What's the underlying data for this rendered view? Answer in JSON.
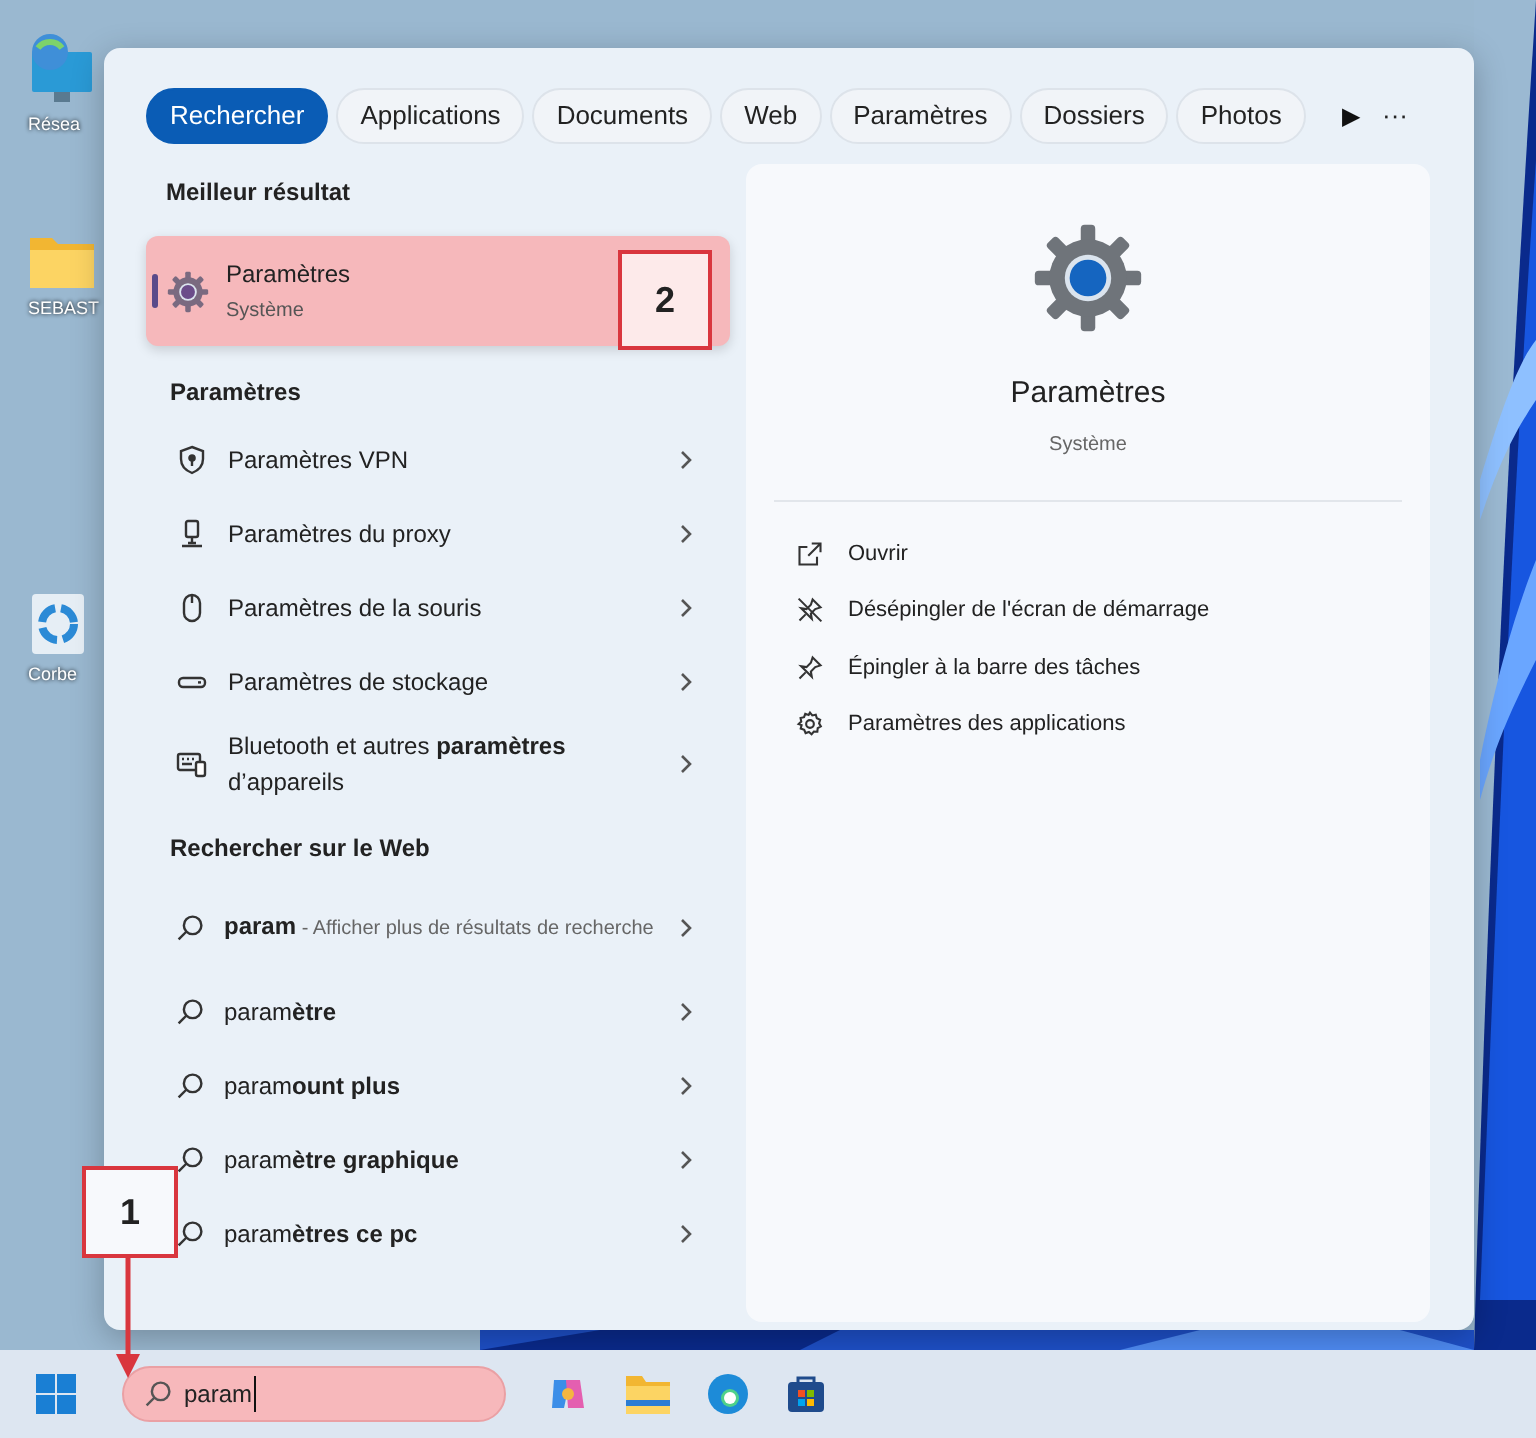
{
  "desktop_icons": [
    {
      "kind": "network",
      "label": "Résea"
    },
    {
      "kind": "folder",
      "label": "SEBAST"
    },
    {
      "kind": "recycle",
      "label": "Corbe"
    }
  ],
  "tabs": [
    {
      "label": "Rechercher",
      "selected": true
    },
    {
      "label": "Applications",
      "selected": false
    },
    {
      "label": "Documents",
      "selected": false
    },
    {
      "label": "Web",
      "selected": false
    },
    {
      "label": "Paramètres",
      "selected": false
    },
    {
      "label": "Dossiers",
      "selected": false
    },
    {
      "label": "Photos",
      "selected": false
    }
  ],
  "tabs_more": "▶",
  "menu": "···",
  "best_match": {
    "heading": "Meilleur résultat",
    "title": "Paramètres",
    "subtitle": "Système",
    "selected": true
  },
  "settings": {
    "heading": "Paramètres",
    "items": [
      {
        "kind": "shield",
        "text": "Paramètres VPN"
      },
      {
        "kind": "proxy",
        "text": "Paramètres du proxy"
      },
      {
        "kind": "mouse",
        "text": "Paramètres de la souris"
      },
      {
        "kind": "storage",
        "text": "Paramètres de stockage"
      },
      {
        "kind": "keyboard",
        "text": "Bluetooth et autres **paramètres** d’appareils"
      }
    ]
  },
  "web": {
    "heading": "Rechercher sur le Web",
    "items": [
      {
        "text": "**param**",
        "detail": "- Afficher plus de résultats de recherche"
      },
      {
        "text": "param**ètre**"
      },
      {
        "text": "param**ount plus**"
      },
      {
        "text": "param**ètre graphique**"
      },
      {
        "text": "param**ètres ce pc**"
      }
    ]
  },
  "preview": {
    "title": "Paramètres",
    "subtitle": "Système",
    "actions": [
      {
        "kind": "open",
        "label": "Ouvrir"
      },
      {
        "kind": "unpin",
        "label": "Désépingler de l'écran de démarrage"
      },
      {
        "kind": "pin",
        "label": "Épingler à la barre des tâches"
      },
      {
        "kind": "gear",
        "label": "Paramètres des applications"
      }
    ]
  },
  "taskbar": {
    "search_value": "param",
    "apps": [
      {
        "kind": "copilot"
      },
      {
        "kind": "explorer"
      },
      {
        "kind": "edge"
      },
      {
        "kind": "store"
      }
    ]
  },
  "callouts": [
    {
      "label": "2"
    },
    {
      "label": "1"
    }
  ]
}
